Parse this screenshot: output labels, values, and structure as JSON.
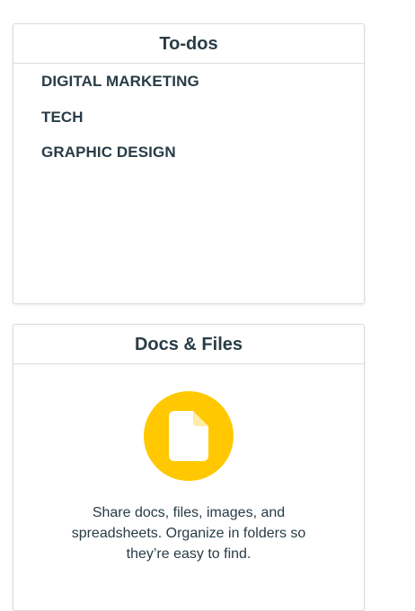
{
  "colors": {
    "text": "#283c46",
    "docs_icon_bg": "#ffc800",
    "docs_icon_fg": "#ffffff"
  },
  "todos": {
    "title": "To-dos",
    "items": [
      {
        "label": "DIGITAL MARKETING"
      },
      {
        "label": "TECH"
      },
      {
        "label": "GRAPHIC DESIGN"
      }
    ]
  },
  "docs": {
    "title": "Docs & Files",
    "icon": "document-icon",
    "description": "Share docs, files, images, and spreadsheets. Organize in folders so they’re easy to find."
  }
}
